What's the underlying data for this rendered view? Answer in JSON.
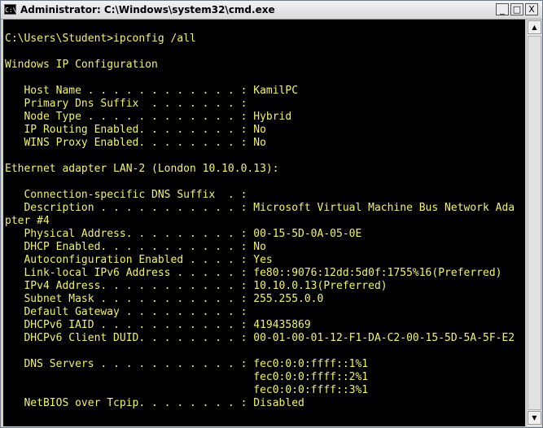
{
  "window": {
    "icon_text": "C:\\",
    "title": "Administrator: C:\\Windows\\system32\\cmd.exe",
    "minimize_glyph": "_",
    "maximize_glyph": "□",
    "close_glyph": "X"
  },
  "console": {
    "lines": [
      "C:\\Users\\Student>ipconfig /all",
      "",
      "Windows IP Configuration",
      "",
      "   Host Name . . . . . . . . . . . . : KamilPC",
      "   Primary Dns Suffix  . . . . . . . :",
      "   Node Type . . . . . . . . . . . . : Hybrid",
      "   IP Routing Enabled. . . . . . . . : No",
      "   WINS Proxy Enabled. . . . . . . . : No",
      "",
      "Ethernet adapter LAN-2 (London 10.10.0.13):",
      "",
      "   Connection-specific DNS Suffix  . :",
      "   Description . . . . . . . . . . . : Microsoft Virtual Machine Bus Network Ada",
      "pter #4",
      "   Physical Address. . . . . . . . . : 00-15-5D-0A-05-0E",
      "   DHCP Enabled. . . . . . . . . . . : No",
      "   Autoconfiguration Enabled . . . . : Yes",
      "   Link-local IPv6 Address . . . . . : fe80::9076:12dd:5d0f:1755%16(Preferred)",
      "   IPv4 Address. . . . . . . . . . . : 10.10.0.13(Preferred)",
      "   Subnet Mask . . . . . . . . . . . : 255.255.0.0",
      "   Default Gateway . . . . . . . . . :",
      "   DHCPv6 IAID . . . . . . . . . . . : 419435869",
      "   DHCPv6 Client DUID. . . . . . . . : 00-01-00-01-12-F1-DA-C2-00-15-5D-5A-5F-E2",
      "",
      "   DNS Servers . . . . . . . . . . . : fec0:0:0:ffff::1%1",
      "                                       fec0:0:0:ffff::2%1",
      "                                       fec0:0:0:ffff::3%1",
      "   NetBIOS over Tcpip. . . . . . . . : Disabled"
    ]
  },
  "scrollbar": {
    "up_glyph": "▲",
    "down_glyph": "▼"
  },
  "colors": {
    "console_bg": "#000000",
    "console_text": "#f0f080"
  }
}
